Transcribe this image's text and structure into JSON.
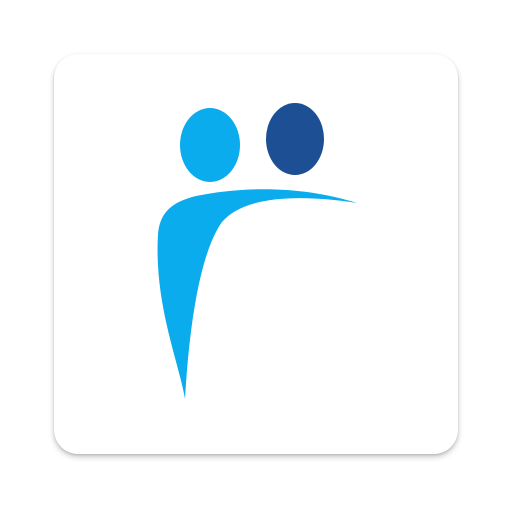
{
  "icon": {
    "name": "people-logo-icon",
    "background": "#ffffff",
    "colors": {
      "light_blue": "#0AACED",
      "dark_blue": "#1C4F94"
    }
  }
}
